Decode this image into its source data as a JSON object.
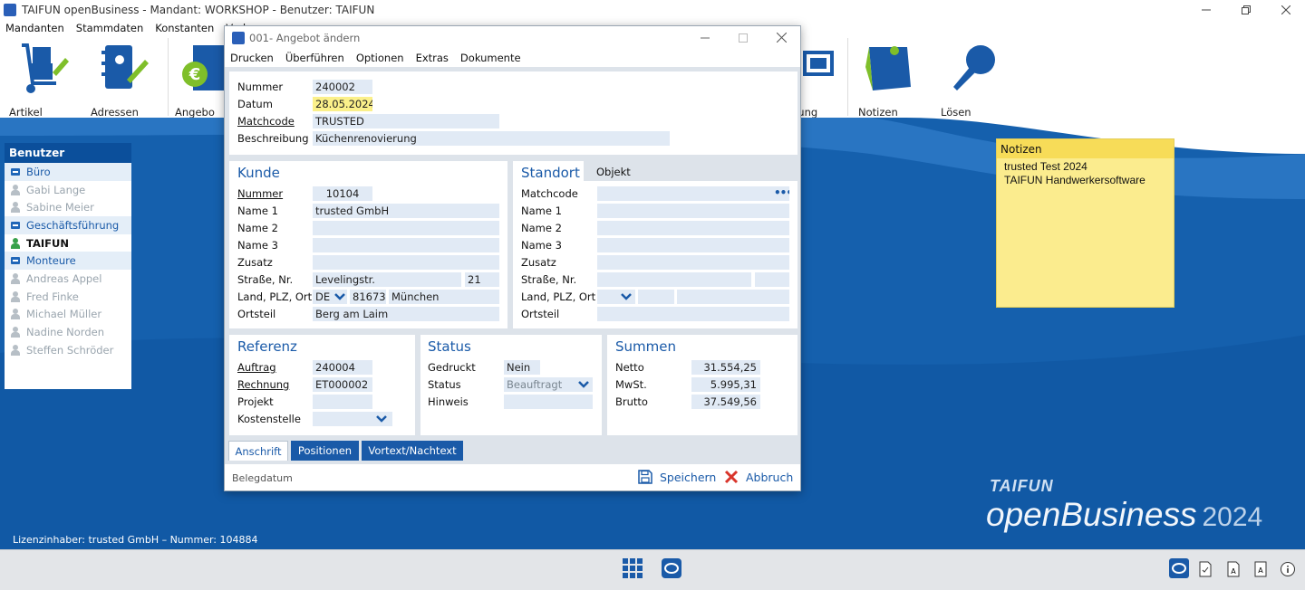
{
  "window": {
    "title": "TAIFUN openBusiness - Mandant: WORKSHOP - Benutzer: TAIFUN"
  },
  "menu": [
    "Mandanten",
    "Stammdaten",
    "Konstanten",
    "Verk"
  ],
  "ribbon": {
    "artikel": "Artikel",
    "adressen": "Adressen",
    "angebote": "Angebo",
    "wartung": "artung",
    "notizen": "Notizen",
    "loesen": "Lösen"
  },
  "users": {
    "title": "Benutzer",
    "rows": [
      {
        "label": "Büro",
        "kind": "group"
      },
      {
        "label": "Gabi Lange",
        "kind": "inactive"
      },
      {
        "label": "Sabine Meier",
        "kind": "inactive"
      },
      {
        "label": "Geschäftsführung",
        "kind": "group"
      },
      {
        "label": "TAIFUN",
        "kind": "active"
      },
      {
        "label": "Monteure",
        "kind": "group"
      },
      {
        "label": "Andreas Appel",
        "kind": "inactive"
      },
      {
        "label": "Fred Finke",
        "kind": "inactive"
      },
      {
        "label": "Michael Müller",
        "kind": "inactive"
      },
      {
        "label": "Nadine Norden",
        "kind": "inactive"
      },
      {
        "label": "Steffen Schröder",
        "kind": "inactive"
      }
    ]
  },
  "note": {
    "title": "Notizen",
    "line1": "trusted Test 2024",
    "line2": "TAIFUN Handwerkersoftware"
  },
  "brand": {
    "name": "TAIFUN",
    "product": "openBusiness",
    "year": "2024"
  },
  "license": "Lizenzinhaber: trusted GmbH – Nummer: 104884",
  "dialog": {
    "title": "001- Angebot ändern",
    "menu": [
      "Drucken",
      "Überführen",
      "Optionen",
      "Extras",
      "Dokumente"
    ],
    "header": {
      "nummer_label": "Nummer",
      "nummer": "240002",
      "datum_label": "Datum",
      "datum": "28.05.2024",
      "matchcode_label": "Matchcode",
      "matchcode": "TRUSTED",
      "beschreibung_label": "Beschreibung",
      "beschreibung": "Küchenrenovierung"
    },
    "kunde": {
      "title": "Kunde",
      "nummer_label": "Nummer",
      "nummer": "10104",
      "name1_label": "Name 1",
      "name1": "trusted GmbH",
      "name2_label": "Name 2",
      "name2": "",
      "name3_label": "Name 3",
      "name3": "",
      "zusatz_label": "Zusatz",
      "zusatz": "",
      "strasse_label": "Straße, Nr.",
      "strasse": "Levelingstr.",
      "hausnr": "21",
      "land_label": "Land, PLZ, Ort",
      "land": "DE",
      "plz": "81673",
      "ort": "München",
      "ortsteil_label": "Ortsteil",
      "ortsteil": "Berg am Laim"
    },
    "standort": {
      "title": "Standort",
      "tab2": "Objekt",
      "matchcode_label": "Matchcode",
      "name1_label": "Name 1",
      "name2_label": "Name 2",
      "name3_label": "Name 3",
      "zusatz_label": "Zusatz",
      "strasse_label": "Straße, Nr.",
      "land_label": "Land, PLZ, Ort",
      "ortsteil_label": "Ortsteil"
    },
    "referenz": {
      "title": "Referenz",
      "auftrag_label": "Auftrag",
      "auftrag": "240004",
      "rechnung_label": "Rechnung",
      "rechnung": "ET000002",
      "projekt_label": "Projekt",
      "projekt": "",
      "kostenstelle_label": "Kostenstelle"
    },
    "status": {
      "title": "Status",
      "gedruckt_label": "Gedruckt",
      "gedruckt": "Nein",
      "status_label": "Status",
      "status": "Beauftragt",
      "hinweis_label": "Hinweis",
      "hinweis": ""
    },
    "summen": {
      "title": "Summen",
      "netto_label": "Netto",
      "netto": "31.554,25",
      "mwst_label": "MwSt.",
      "mwst": "5.995,31",
      "brutto_label": "Brutto",
      "brutto": "37.549,56"
    },
    "tabs": [
      "Anschrift",
      "Positionen",
      "Vortext/Nachtext"
    ],
    "status_text": "Belegdatum",
    "save": "Speichern",
    "cancel": "Abbruch"
  }
}
